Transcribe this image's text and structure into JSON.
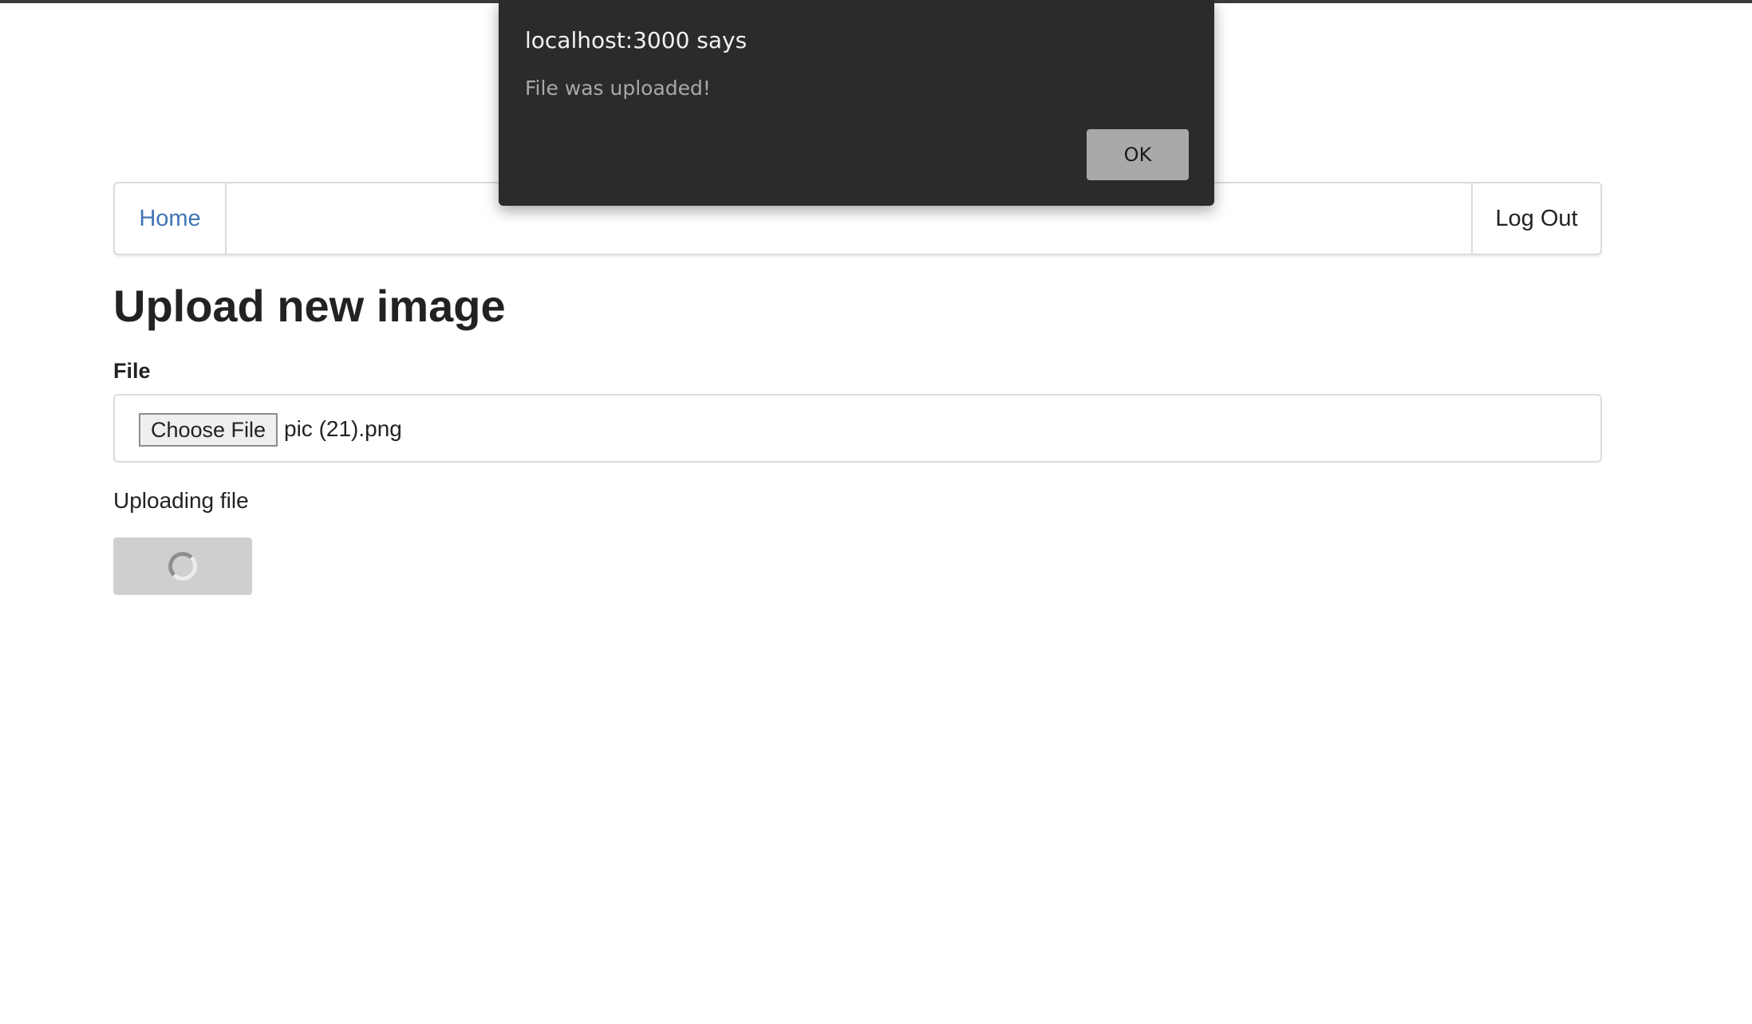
{
  "nav": {
    "home_label": "Home",
    "logout_label": "Log Out"
  },
  "page": {
    "title": "Upload new image",
    "file_label": "File",
    "choose_button_label": "Choose File",
    "selected_file": "pic (21).png",
    "status": "Uploading file"
  },
  "dialog": {
    "title": "localhost:3000 says",
    "message": "File was uploaded!",
    "ok_label": "OK"
  },
  "icons": {
    "loading": "spinner-icon"
  },
  "colors": {
    "link": "#3f74b5",
    "dialog_bg": "#2b2b2b",
    "ok_button": "#a9a9a9",
    "disabled_button": "#cfcfcf"
  }
}
